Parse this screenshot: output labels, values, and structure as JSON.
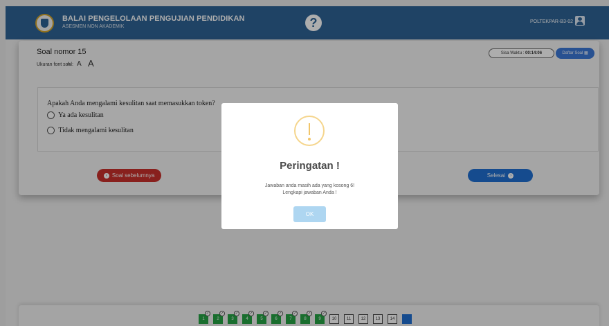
{
  "header": {
    "title": "BALAI PENGELOLAAN PENGUJIAN PENDIDIKAN",
    "subtitle": "ASESMEN NON AKADEMIK",
    "help_glyph": "?",
    "user_label": "POLTEKPAR-B3-02"
  },
  "question": {
    "title": "Soal nomor 15",
    "font_size_label": "Ukuran font soal:",
    "font_sizes": [
      "A",
      "A",
      "A"
    ],
    "timer_label": "Sisa Waktu :",
    "timer_value": "00:14:06",
    "list_button": "Daftar Soal",
    "text": "Apakah Anda mengalami kesulitan saat memasukkan token?",
    "options": [
      "Ya ada kesulitan",
      "Tidak mengalami kesulitan"
    ],
    "prev_button": "Soal sebelumnya",
    "finish_button": "Selesai"
  },
  "navigator": {
    "numbers": [
      "1",
      "2",
      "3",
      "4",
      "5",
      "6",
      "7",
      "8",
      "9",
      "10",
      "11",
      "12",
      "13",
      "14",
      "15"
    ],
    "answered": [
      1,
      2,
      3,
      4,
      5,
      6,
      7,
      8,
      9
    ],
    "current": 15
  },
  "modal": {
    "title": "Peringatan !",
    "message_line1": "Jawaban anda masih ada yang kosong 6!",
    "message_line2": "Lengkapi jawaban Anda !",
    "ok_button": "OK"
  },
  "icons": {
    "logo": "tut-wuri-handayani-logo",
    "help": "question-circle-icon",
    "user": "user-avatar-icon",
    "warning": "exclamation-circle-icon",
    "grid": "grid-icon",
    "prev": "chevron-left-circle-icon",
    "next": "chevron-right-circle-icon",
    "check": "check-circle-icon"
  },
  "colors": {
    "header_bg": "#2f6395",
    "prev_button": "#c9302c",
    "finish_button": "#1f6fd1",
    "answered": "#25a244",
    "warning": "#f1c56a"
  }
}
